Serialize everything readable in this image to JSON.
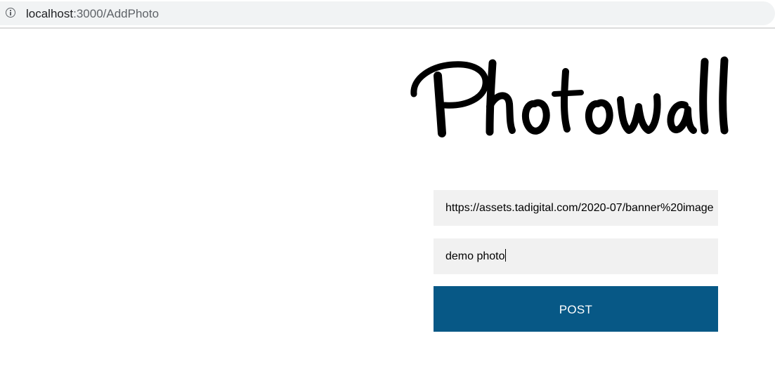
{
  "browser": {
    "url_host": "localhost",
    "url_rest": ":3000/AddPhoto",
    "info_icon": "info-icon"
  },
  "header": {
    "logo_text": "Photowall"
  },
  "form": {
    "link_value": "https://assets.tadigital.com/2020-07/banner%20image",
    "description_value": "demo photo",
    "post_label": "POST"
  },
  "colors": {
    "button_bg": "#075886",
    "field_bg": "#f1f1f1",
    "button_text": "#ffffff"
  }
}
